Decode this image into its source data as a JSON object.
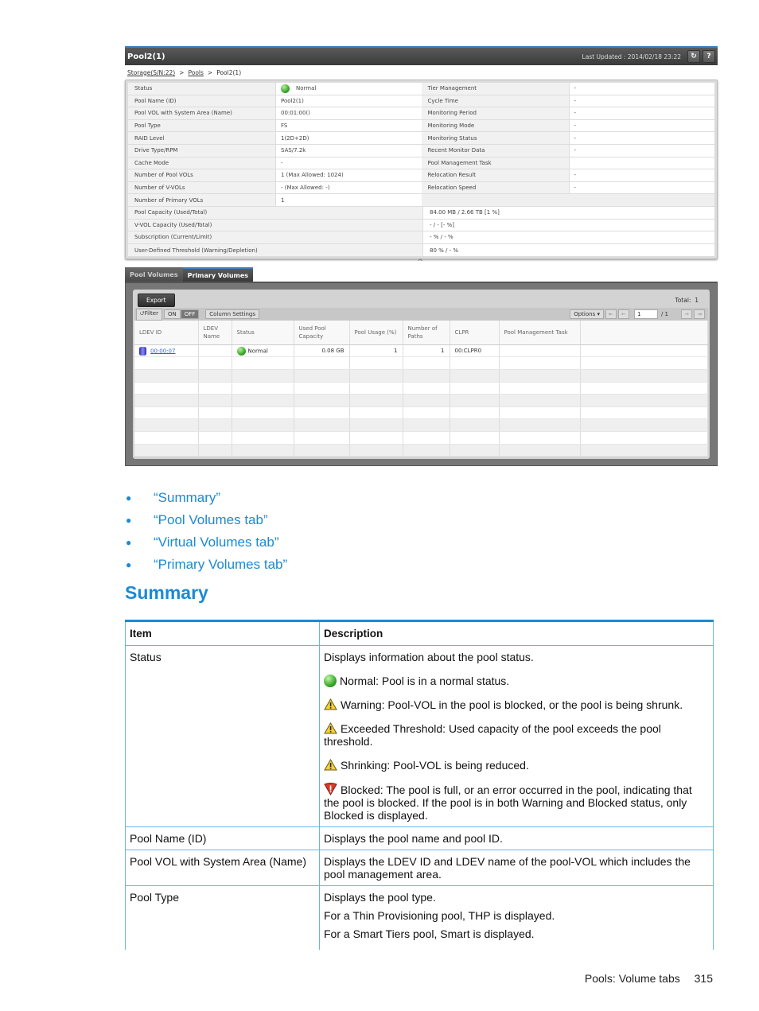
{
  "screenshot": {
    "window_title": "Pool2(1)",
    "last_updated": "Last Updated : 2014/02/18 23:22",
    "refresh_icon": "refresh-icon",
    "help_label": "?",
    "breadcrumb": [
      "Storage(S/N:22)",
      "Pools",
      "Pool2(1)"
    ],
    "breadcrumb_sep": ">",
    "summary_left": [
      {
        "label": "Status",
        "value": "Normal",
        "icon": "green-status-icon"
      },
      {
        "label": "Pool Name (ID)",
        "value": "Pool2(1)"
      },
      {
        "label": "Pool VOL with System Area (Name)",
        "value": "00:01:00()"
      },
      {
        "label": "Pool Type",
        "value": "FS"
      },
      {
        "label": "RAID Level",
        "value": "1(2D+2D)"
      },
      {
        "label": "Drive Type/RPM",
        "value": "SAS/7.2k"
      },
      {
        "label": "Cache Mode",
        "value": "-"
      },
      {
        "label": "Number of Pool VOLs",
        "value": "1 (Max Allowed: 1024)"
      },
      {
        "label": "Number of V-VOLs",
        "value": "- (Max Allowed: -)"
      },
      {
        "label": "Number of Primary VOLs",
        "value": "1"
      }
    ],
    "summary_right": [
      {
        "label": "Tier Management",
        "value": "-"
      },
      {
        "label": "Cycle Time",
        "value": "-"
      },
      {
        "label": "Monitoring Period",
        "value": "-"
      },
      {
        "label": "Monitoring Mode",
        "value": "-"
      },
      {
        "label": "Monitoring Status",
        "value": "-"
      },
      {
        "label": "Recent Monitor Data",
        "value": "-"
      },
      {
        "label": "Pool Management Task",
        "value": ""
      },
      {
        "label": "Relocation Result",
        "value": "-"
      },
      {
        "label": "Relocation Speed",
        "value": "-"
      }
    ],
    "summary_wide": [
      {
        "label": "Pool Capacity (Used/Total)",
        "value": "84.00 MB / 2.66 TB [1 %]"
      },
      {
        "label": "V-VOL Capacity (Used/Total)",
        "value": "- / - [- %]"
      },
      {
        "label": "Subscription (Current/Limit)",
        "value": "- % / - %"
      },
      {
        "label": "User-Defined Threshold (Warning/Depletion)",
        "value": "80 % / - %"
      }
    ],
    "collapse_caret": "^",
    "tabs": [
      {
        "label": "Pool Volumes",
        "active": false
      },
      {
        "label": "Primary Volumes",
        "active": true
      }
    ],
    "export_label": "Export",
    "total_label": "Total:",
    "total_value": "1",
    "filter_label": "Filter",
    "filter_on": "ON",
    "filter_off": "OFF",
    "column_settings_label": "Column Settings",
    "options_label": "Options",
    "page_current": "1",
    "page_total": "/ 1",
    "columns": [
      "LDEV ID",
      "LDEV Name",
      "Status",
      "Used Pool Capacity",
      "Pool Usage (%)",
      "Number of Paths",
      "CLPR",
      "Pool Management Task"
    ],
    "rows": [
      {
        "ldev_id": "00:00:07",
        "ldev_name": "",
        "status": "Normal",
        "used_capacity": "0.08 GB",
        "pool_usage": "1",
        "paths": "1",
        "clpr": "00:CLPR0",
        "task": ""
      }
    ]
  },
  "links": [
    {
      "label": "“Summary”"
    },
    {
      "label": "“Pool Volumes tab”"
    },
    {
      "label": "“Virtual Volumes tab”"
    },
    {
      "label": "“Primary Volumes tab”"
    }
  ],
  "section_title": "Summary",
  "doc_table": {
    "headers": [
      "Item",
      "Description"
    ],
    "status": {
      "item": "Status",
      "intro": "Displays information about the pool status.",
      "normal": "Normal: Pool is in a normal status.",
      "warning": "Warning: Pool-VOL in the pool is blocked, or the pool is being shrunk.",
      "exceeded": "Exceeded Threshold: Used capacity of the pool exceeds the pool threshold.",
      "shrinking": "Shrinking: Pool-VOL is being reduced.",
      "blocked": "Blocked: The pool is full, or an error occurred in the pool, indicating that the pool is blocked. If the pool is in both Warning and Blocked status, only Blocked is displayed."
    },
    "pool_name": {
      "item": "Pool Name (ID)",
      "desc": "Displays the pool name and pool ID."
    },
    "pool_vol": {
      "item": "Pool VOL with System Area (Name)",
      "desc": "Displays the LDEV ID and LDEV name of the pool-VOL which includes the pool management area."
    },
    "pool_type": {
      "item": "Pool Type",
      "desc": [
        "Displays the pool type.",
        "For a Thin Provisioning pool, THP is displayed.",
        "For a Smart Tiers pool, Smart is displayed."
      ]
    }
  },
  "footer": {
    "section": "Pools: Volume tabs",
    "page": "315"
  },
  "colors": {
    "accent": "#1a8ad4",
    "table_border": "#6cb4e4",
    "titlebar": "#3a3a3a",
    "link": "#3366cc"
  }
}
